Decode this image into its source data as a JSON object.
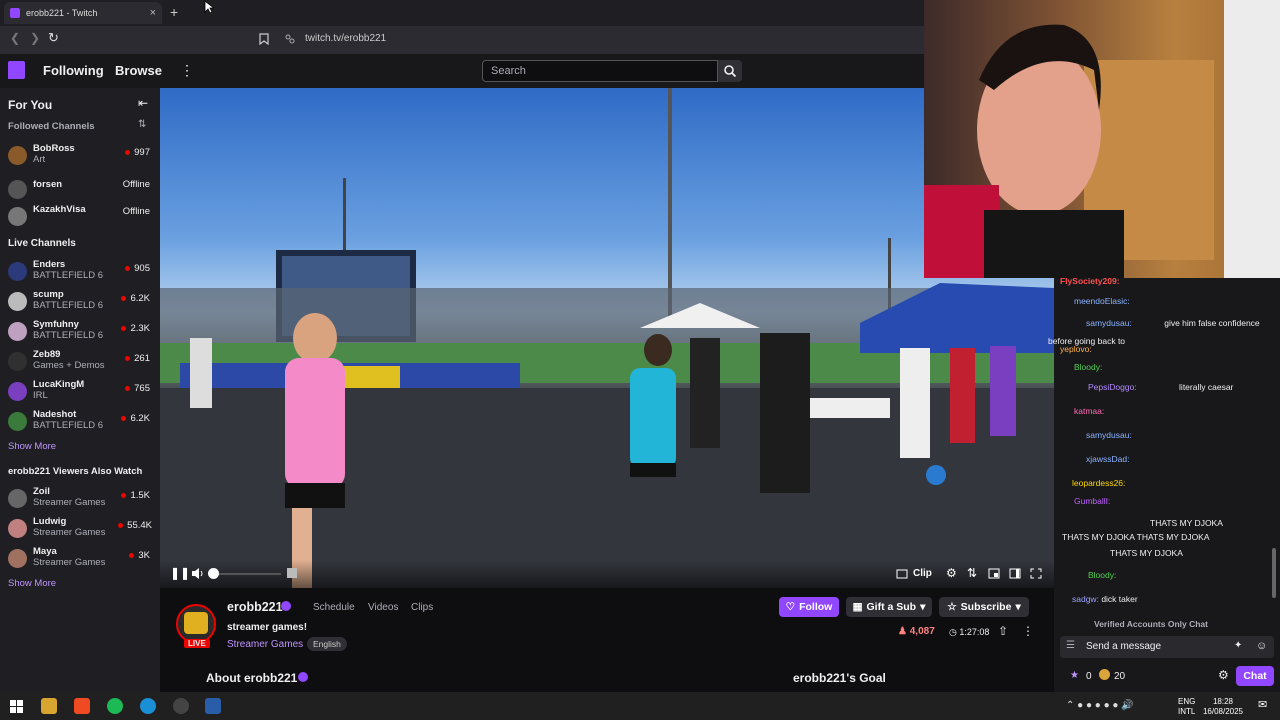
{
  "browser": {
    "tab_title": "erobb221 - Twitch",
    "new_tab": "+",
    "close": "×",
    "url": "twitch.tv/erobb221"
  },
  "nav": {
    "following": "Following",
    "browse": "Browse",
    "search_placeholder": "Search"
  },
  "sidebar": {
    "for_you": "For You",
    "followed_header": "Followed Channels",
    "followed": [
      {
        "name": "BobRoss",
        "game": "Art",
        "viewers": "997",
        "color": "#8b5a2b"
      },
      {
        "name": "forsen",
        "game": "",
        "viewers": "Offline",
        "color": "#555555"
      },
      {
        "name": "KazakhVisa",
        "game": "",
        "viewers": "Offline",
        "color": "#777777"
      }
    ],
    "live_header": "Live Channels",
    "live": [
      {
        "name": "Enders",
        "game": "BATTLEFIELD 6",
        "viewers": "905",
        "color": "#2b3a7a"
      },
      {
        "name": "scump",
        "game": "BATTLEFIELD 6",
        "viewers": "6.2K",
        "color": "#bbbbbb"
      },
      {
        "name": "Symfuhny",
        "game": "BATTLEFIELD 6",
        "viewers": "2.3K",
        "color": "#c0a0c0"
      },
      {
        "name": "Zeb89",
        "game": "Games + Demos",
        "viewers": "261",
        "color": "#303030"
      },
      {
        "name": "LucaKingM",
        "game": "IRL",
        "viewers": "765",
        "color": "#7a3fbf"
      },
      {
        "name": "Nadeshot",
        "game": "BATTLEFIELD 6",
        "viewers": "6.2K",
        "color": "#3a7a3a"
      }
    ],
    "show_more_1": "Show More",
    "also_watch_header": "erobb221 Viewers Also Watch",
    "also_watch": [
      {
        "name": "Zoil",
        "game": "Streamer Games",
        "viewers": "1.5K",
        "color": "#666666"
      },
      {
        "name": "Ludwig",
        "game": "Streamer Games",
        "viewers": "55.4K",
        "color": "#c08080"
      },
      {
        "name": "Maya",
        "game": "Streamer Games",
        "viewers": "3K",
        "color": "#a07060"
      }
    ],
    "show_more_2": "Show More"
  },
  "player": {
    "clip_label": "Clip"
  },
  "stream": {
    "channel": "erobb221",
    "tabs": [
      "Schedule",
      "Videos",
      "Clips"
    ],
    "title": "streamer games!",
    "category": "Streamer Games",
    "tag": "English",
    "live_badge": "LIVE",
    "follow": "Follow",
    "gift": "Gift a Sub",
    "subscribe": "Subscribe",
    "viewers": "4,087",
    "uptime": "1:27:08",
    "about": "About erobb221",
    "goal": "erobb221's Goal"
  },
  "chat": {
    "messages": [
      {
        "user": "FlySociety209:",
        "text": "",
        "color": "#ff4f4f"
      },
      {
        "user": "meendoElasic:",
        "text": "",
        "color": "#8ab4ff"
      },
      {
        "user": "samydusau:",
        "text": "give him false confidence",
        "color": "#8ab4ff"
      },
      {
        "user": "",
        "text": "before going back to",
        "color": "#ffffff"
      },
      {
        "user": "yeplovo:",
        "text": "",
        "color": "#ffb347"
      },
      {
        "user": "Bloody:",
        "text": "",
        "color": "#4fd04f"
      },
      {
        "user": "PepsiDoggo:",
        "text": "literally caesar",
        "color": "#b38aff"
      },
      {
        "user": "katmaa:",
        "text": "",
        "color": "#ff69b4"
      },
      {
        "user": "samydusau:",
        "text": "",
        "color": "#8ab4ff"
      },
      {
        "user": "xjawssDad:",
        "text": "",
        "color": "#8ab4ff"
      },
      {
        "user": "leopardess26:",
        "text": "",
        "color": "#ffd700"
      },
      {
        "user": "GumballI:",
        "text": "",
        "color": "#c060ff"
      },
      {
        "user": "",
        "text": "THATS MY DJOKA",
        "color": "#ffffff"
      },
      {
        "user": "",
        "text": "THATS MY DJOKA   THATS MY DJOKA",
        "color": "#ffffff"
      },
      {
        "user": "",
        "text": "THATS MY DJOKA",
        "color": "#ffffff"
      },
      {
        "user": "Bloody:",
        "text": "",
        "color": "#4fd04f"
      },
      {
        "user": "",
        "text": "",
        "color": "#ffffff"
      },
      {
        "user": "sadgw:",
        "text": "dick taker",
        "color": "#a0a0ff"
      }
    ],
    "verified_notice": "Verified Accounts Only Chat",
    "input_placeholder": "Send a message",
    "points": "0",
    "bits": "20",
    "chat_button": "Chat"
  },
  "taskbar": {
    "lang": "ENG",
    "lang2": "INTL",
    "time": "18:28",
    "date": "16/08/2025"
  }
}
